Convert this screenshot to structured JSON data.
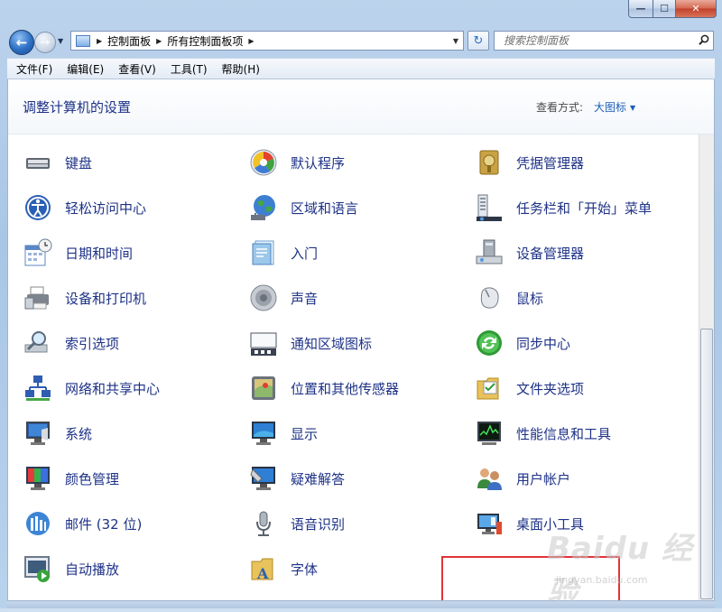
{
  "window": {
    "caption": {
      "minimize": "—",
      "maximize": "☐",
      "close": "✕"
    }
  },
  "nav": {
    "back_glyph": "←",
    "forward_glyph": "→",
    "history_glyph": "▼",
    "address": {
      "crumbs": [
        "控制面板",
        "所有控制面板项"
      ],
      "separator": "▶",
      "dropdown": "▼"
    },
    "refresh_glyph": "↻",
    "search": {
      "placeholder": "搜索控制面板",
      "icon": "search-icon"
    }
  },
  "menu": {
    "items": [
      "文件(F)",
      "编辑(E)",
      "查看(V)",
      "工具(T)",
      "帮助(H)"
    ]
  },
  "header": {
    "title": "调整计算机的设置",
    "view_by_label": "查看方式:",
    "view_mode": "大图标",
    "view_arrow": "▼"
  },
  "items": {
    "col1": [
      "键盘",
      "轻松访问中心",
      "日期和时间",
      "设备和打印机",
      "索引选项",
      "网络和共享中心",
      "系统",
      "颜色管理",
      "邮件 (32 位)",
      "自动播放"
    ],
    "col2": [
      "默认程序",
      "区域和语言",
      "入门",
      "声音",
      "通知区域图标",
      "位置和其他传感器",
      "显示",
      "疑难解答",
      "语音识别",
      "字体"
    ],
    "col3": [
      "凭据管理器",
      "任务栏和「开始」菜单",
      "设备管理器",
      "鼠标",
      "同步中心",
      "文件夹选项",
      "性能信息和工具",
      "用户帐户",
      "桌面小工具"
    ]
  },
  "icons": {
    "col1": [
      "keyboard-icon",
      "ease-of-access-icon",
      "date-time-icon",
      "devices-printers-icon",
      "indexing-options-icon",
      "network-sharing-icon",
      "system-icon",
      "color-management-icon",
      "mail-icon",
      "autoplay-icon"
    ],
    "col2": [
      "default-programs-icon",
      "region-language-icon",
      "getting-started-icon",
      "sound-icon",
      "notification-icons-icon",
      "location-sensors-icon",
      "display-icon",
      "troubleshooting-icon",
      "speech-recognition-icon",
      "fonts-icon"
    ],
    "col3": [
      "credential-manager-icon",
      "taskbar-start-menu-icon",
      "device-manager-icon",
      "mouse-icon",
      "sync-center-icon",
      "folder-options-icon",
      "performance-icon",
      "user-accounts-icon",
      "desktop-gadgets-icon"
    ]
  },
  "watermark": {
    "main": "Baidu 经验",
    "sub": "jingyan.baidu.com"
  },
  "colors": {
    "link": "#1e3287",
    "highlight": "#e2323a",
    "view_mode": "#1c5fb8"
  }
}
